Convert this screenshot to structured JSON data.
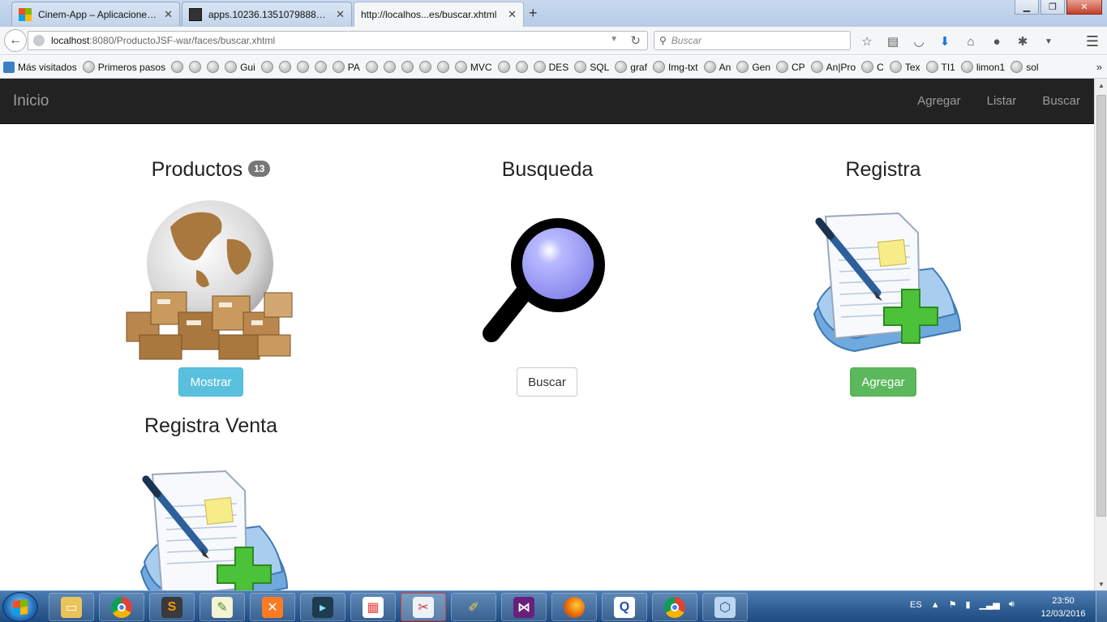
{
  "browser": {
    "tabs": [
      {
        "title": "Cinem-App – Aplicaciones...",
        "icon": "windows-logo-icon"
      },
      {
        "title": "apps.10236.1351079888371...",
        "icon": "app-thumbnail-icon"
      },
      {
        "title": "http://localhos...es/buscar.xhtml",
        "icon": ""
      }
    ],
    "new_tab": "+",
    "window_buttons": {
      "minimize": "▁",
      "restore": "❐",
      "close": "✕"
    },
    "url": {
      "host": "localhost",
      "rest": ":8080/ProductoJSF-war/faces/buscar.xhtml"
    },
    "search_placeholder": "Buscar",
    "bookmarks": [
      "Más visitados",
      "Primeros pasos",
      "",
      "",
      "",
      "Gui",
      "",
      "",
      "",
      "",
      "PA",
      "",
      "",
      "",
      "",
      "",
      "MVC",
      "",
      "",
      "DES",
      "SQL",
      "graf",
      "Img-txt",
      "An",
      "Gen",
      "CP",
      "An|Pro",
      "C",
      "Tex",
      "TI1",
      "limon1",
      "sol"
    ]
  },
  "app": {
    "brand": "Inicio",
    "nav": [
      "Agregar",
      "Listar",
      "Buscar"
    ],
    "sections": {
      "productos": {
        "title": "Productos",
        "badge": "13",
        "button": "Mostrar"
      },
      "busqueda": {
        "title": "Busqueda",
        "button": "Buscar"
      },
      "registra": {
        "title": "Registra",
        "button": "Agregar"
      },
      "registra_venta": {
        "title": "Registra Venta"
      }
    },
    "colors": {
      "navbar": "#222222",
      "info": "#5bc0de",
      "success": "#5cb85c",
      "badge": "#777777"
    }
  },
  "taskbar": {
    "items": [
      "file-explorer-icon",
      "chrome-icon",
      "sublime-text-icon",
      "text-editor-icon",
      "xampp-icon",
      "terminal-icon",
      "app-grid-icon",
      "snipping-tool-icon",
      "paint-tool-icon",
      "visual-studio-icon",
      "firefox-icon",
      "q-app-icon",
      "chrome-icon",
      "virtualbox-icon"
    ],
    "language": "ES",
    "time": "23:50",
    "date": "12/03/2016"
  }
}
